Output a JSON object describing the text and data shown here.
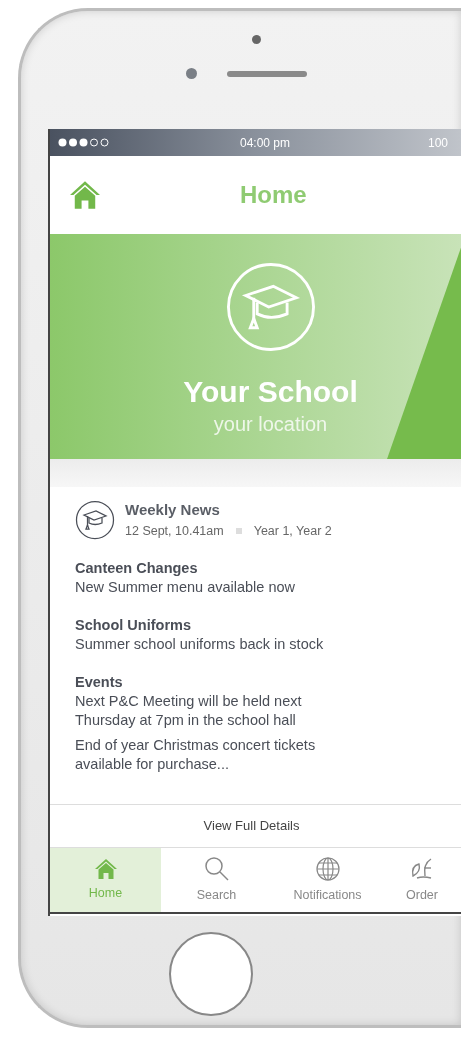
{
  "status_bar": {
    "time": "04:00 pm",
    "battery": "100"
  },
  "header": {
    "title": "Home"
  },
  "hero": {
    "name": "Your School",
    "location": "your location"
  },
  "news": {
    "title": "Weekly News",
    "date": "12 Sept, 10.41am",
    "audience": "Year 1, Year 2",
    "sections": [
      {
        "heading": "Canteen Changes",
        "paragraphs": [
          "New Summer menu available now"
        ]
      },
      {
        "heading": "School Uniforms",
        "paragraphs": [
          "Summer school uniforms back in stock"
        ]
      },
      {
        "heading": "Events",
        "paragraphs": [
          "Next P&C Meeting will be held next Thursday at 7pm in the school hall",
          "End of year Christmas concert tickets available for purchase..."
        ]
      }
    ],
    "link": "View Full Details"
  },
  "tabs": [
    {
      "label": "Home",
      "kind": "home",
      "selected": true
    },
    {
      "label": "Search",
      "kind": "search",
      "selected": false
    },
    {
      "label": "Notifications",
      "kind": "globe",
      "selected": false
    },
    {
      "label": "Order",
      "kind": "order",
      "selected": false
    }
  ]
}
